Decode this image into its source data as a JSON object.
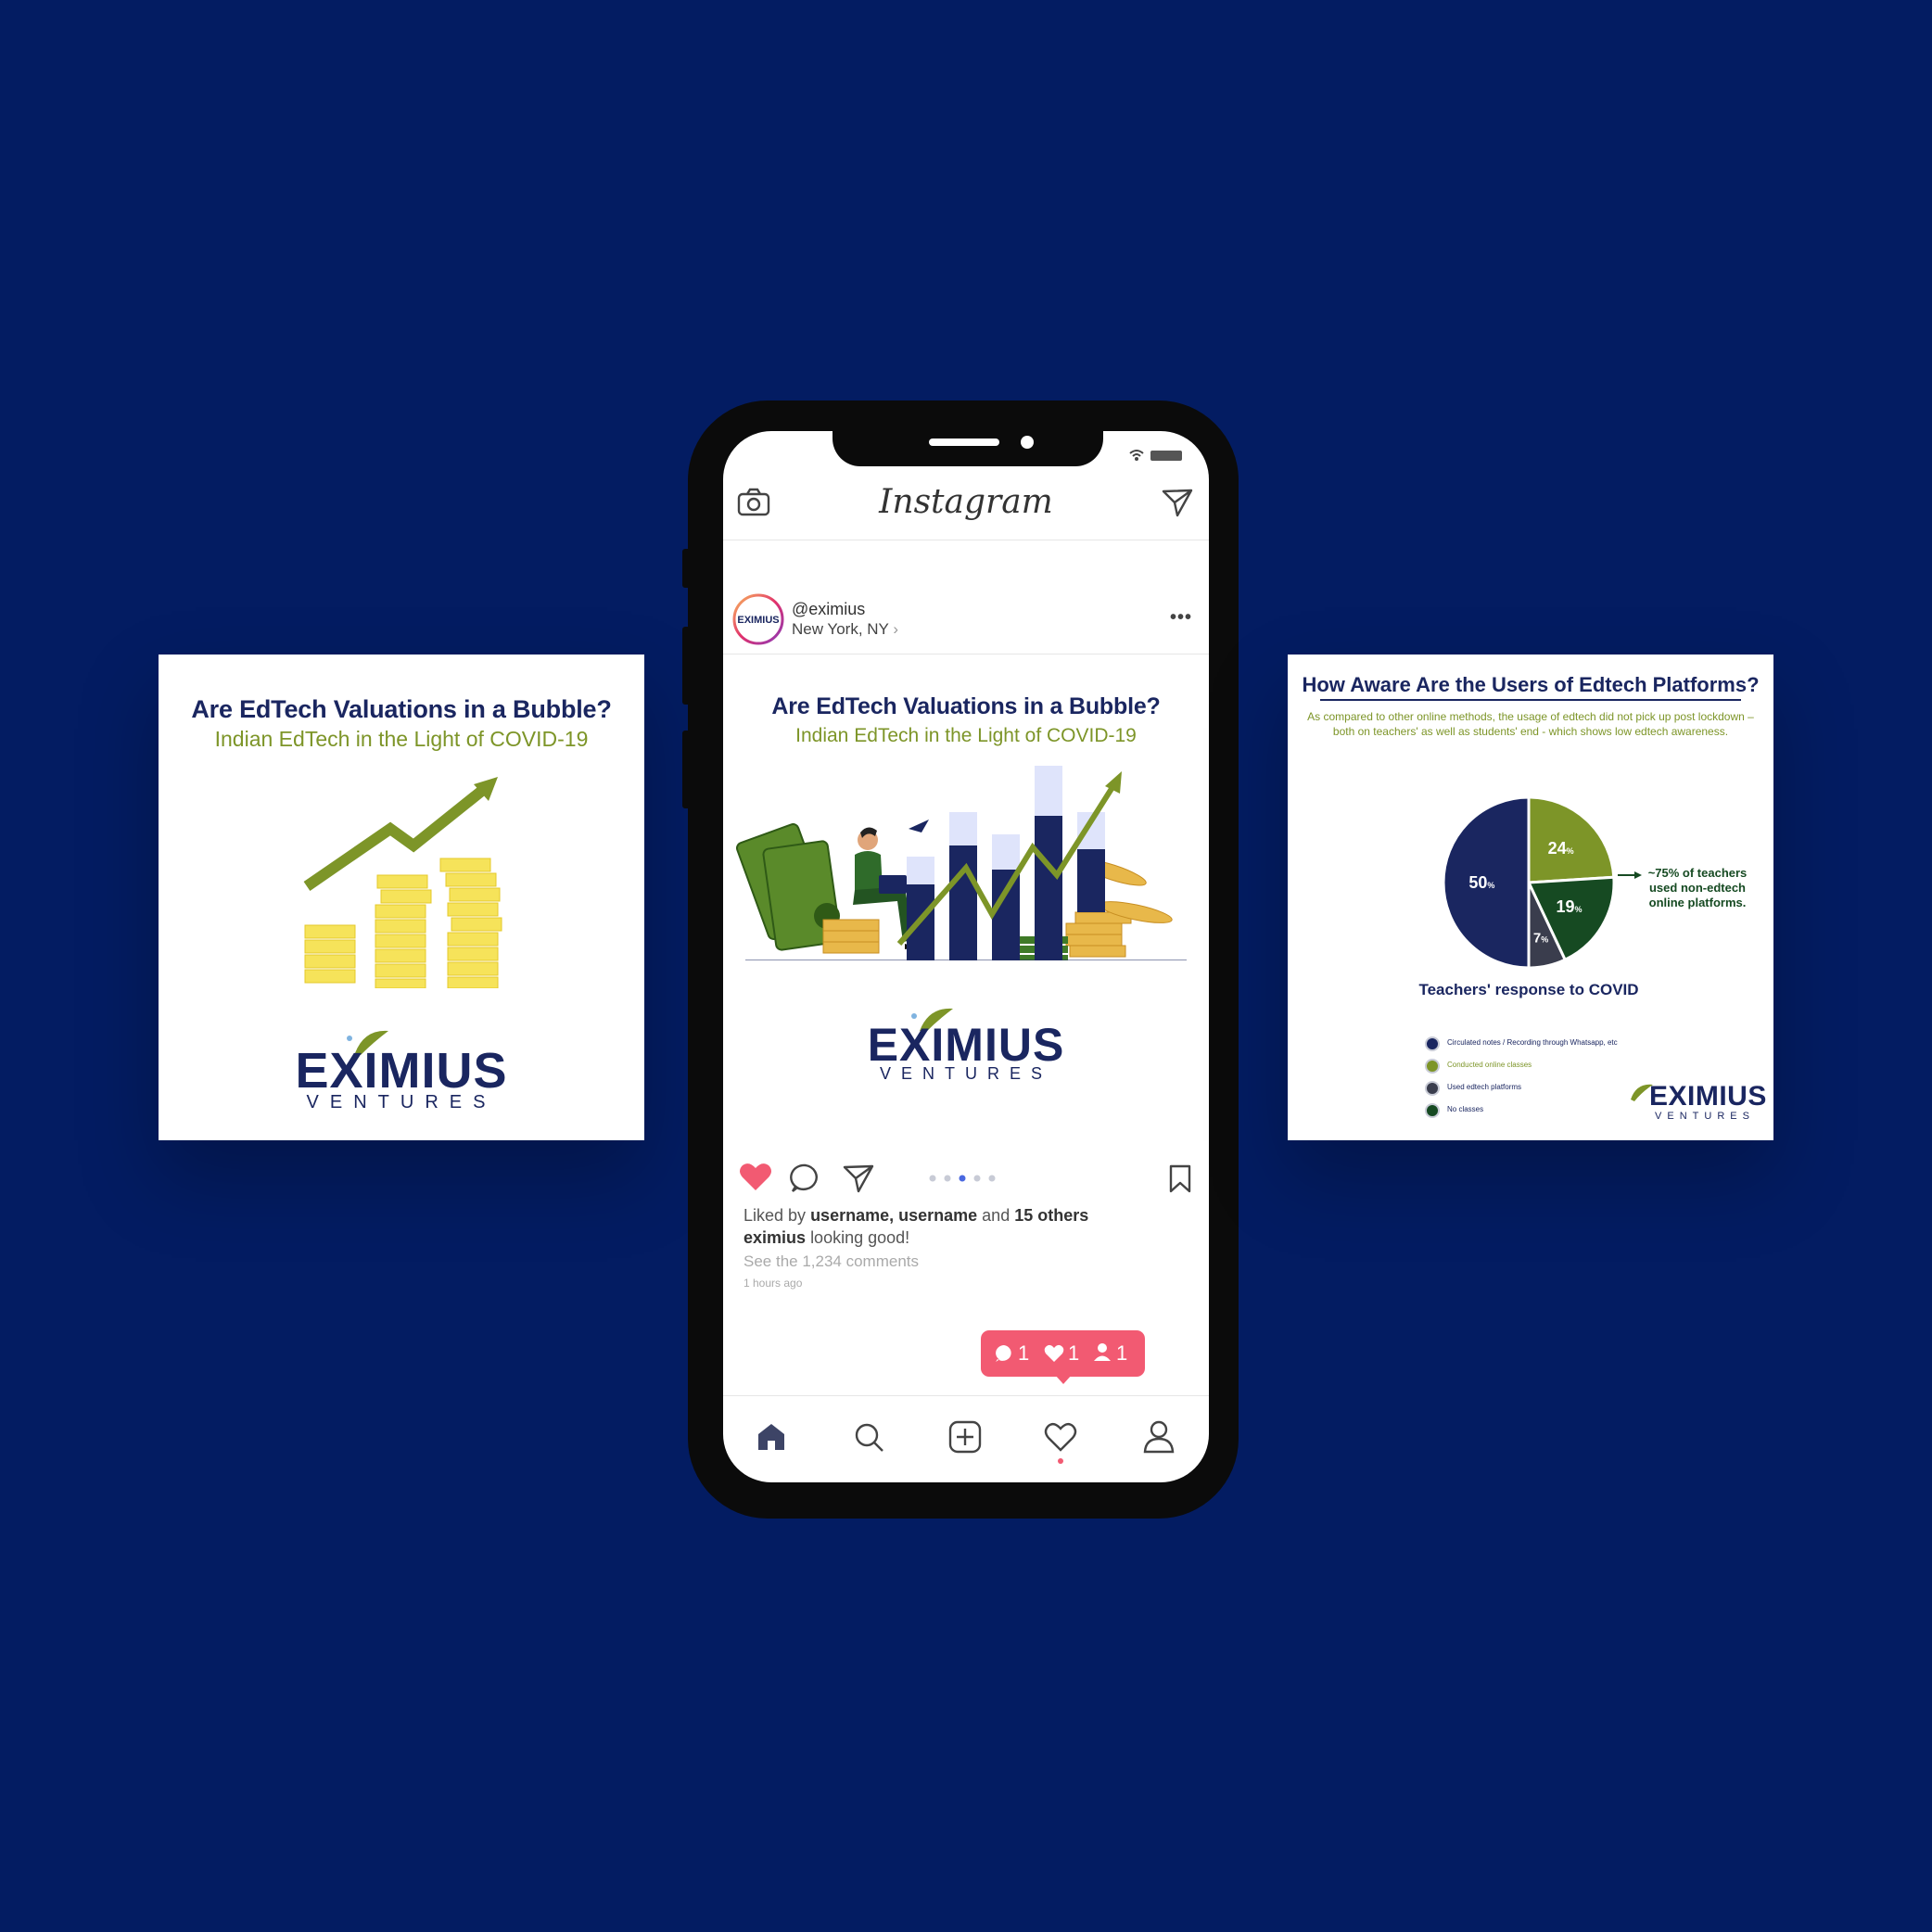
{
  "colors": {
    "background": "#031c62",
    "navy": "#1a2660",
    "olive": "#7d9528",
    "dark_green": "#164a22",
    "slate": "#3a3d4d",
    "heart": "#f25a72"
  },
  "left_card": {
    "title": "Are EdTech Valuations in a Bubble?",
    "subtitle": "Indian EdTech in the Light of COVID-19",
    "logo_main": "EXIMIUS",
    "logo_sub": "VENTURES"
  },
  "phone": {
    "app_title": "Instagram",
    "icons": {
      "camera": "camera-icon",
      "direct": "paper-plane-icon",
      "more": "more-dots-icon"
    },
    "post": {
      "username": "@eximius",
      "location": "New York, NY",
      "title": "Are EdTech Valuations in a Bubble?",
      "subtitle": "Indian EdTech in the Light of COVID-19",
      "logo_main": "EXIMIUS",
      "logo_sub": "VENTURES",
      "liked_prefix": "Liked by",
      "liked_users": "username, username",
      "liked_and": "and",
      "liked_others": "15 others",
      "caption_user": "eximius",
      "caption_text": "looking good!",
      "comments_link": "See the 1,234 comments",
      "time_ago": "1 hours ago",
      "carousel": {
        "count": 5,
        "active": 3
      }
    },
    "notifications": {
      "comments": "1",
      "likes": "1",
      "follows": "1"
    },
    "bottom_nav": [
      "home-icon",
      "search-icon",
      "add-icon",
      "activity-heart-icon",
      "profile-icon"
    ]
  },
  "right_card": {
    "title": "How Aware Are the Users of Edtech Platforms?",
    "subtitle": "As compared to other online methods, the usage of edtech did not pick up post lockdown – both on teachers' as well as students' end - which shows low edtech awareness.",
    "annotation": "~75% of teachers used non-edtech online platforms.",
    "logo_main": "EXIMIUS",
    "logo_sub": "VENTURES",
    "chart_data": {
      "type": "pie",
      "title": "Teachers' response to COVID",
      "slices": [
        {
          "label": "Circulated notes / Recording through Whatsapp, etc",
          "value": 50,
          "display": "50",
          "color": "#1a2660"
        },
        {
          "label": "Conducted online classes",
          "value": 24,
          "display": "24",
          "color": "#7d9528"
        },
        {
          "label": "Used edtech platforms",
          "value": 7,
          "display": "7",
          "color": "#3a3d4d"
        },
        {
          "label": "No classes",
          "value": 19,
          "display": "19",
          "color": "#164a22"
        }
      ],
      "unit": "%",
      "legend_placement": "bottom-left"
    }
  }
}
